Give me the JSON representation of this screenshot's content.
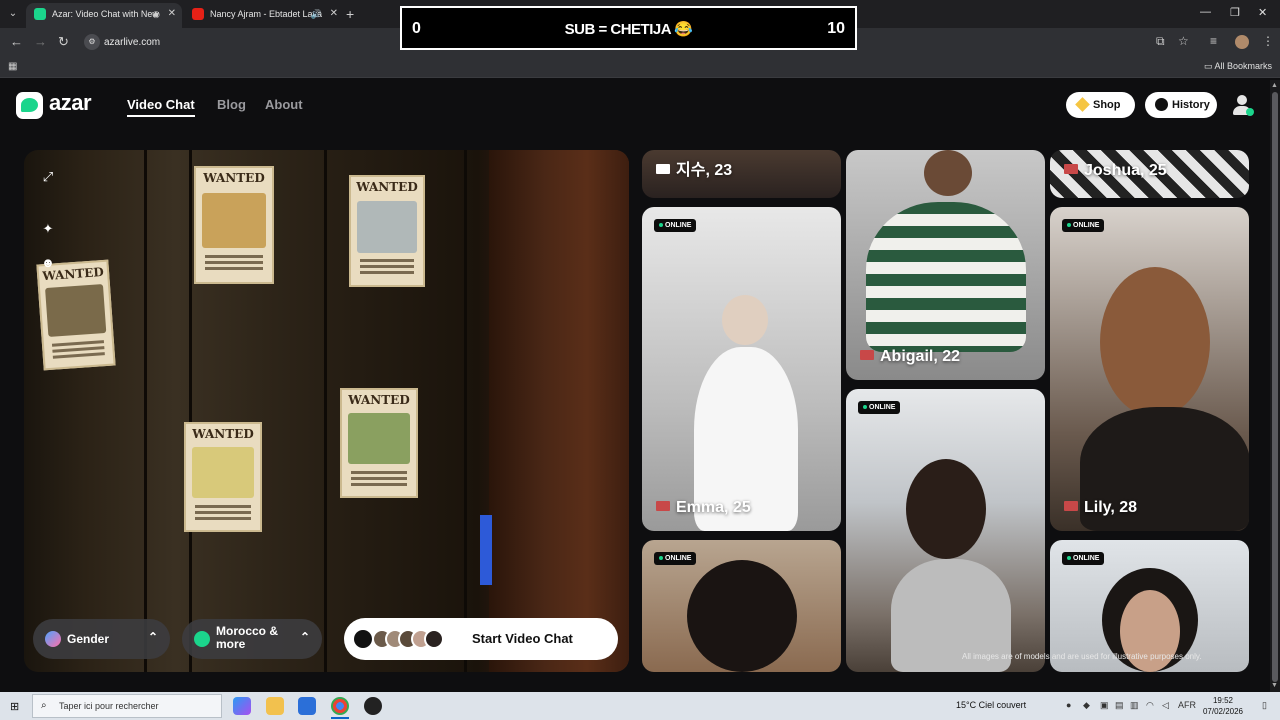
{
  "browser": {
    "tabs": [
      {
        "title": "Azar: Video Chat with New",
        "active": true
      },
      {
        "title": "Nancy Ajram - Ebtadet Laya",
        "active": false
      }
    ],
    "url": "azarlive.com",
    "bookmarks_label": "All Bookmarks"
  },
  "overlay": {
    "left_value": "0",
    "text": "SUB = CHETIJA 😂",
    "right_value": "10"
  },
  "site": {
    "brand": "azar",
    "nav": [
      "Video Chat",
      "Blog",
      "About"
    ],
    "shop_label": "Shop",
    "history_label": "History"
  },
  "controls": {
    "gender_label": "Gender",
    "region_label_1": "Morocco &",
    "region_label_2": "more",
    "start_label": "Start Video Chat"
  },
  "profiles": [
    {
      "name": "지수, 23",
      "online": false
    },
    {
      "name": "Abigail, 22",
      "online": false
    },
    {
      "name": "Joshua, 25",
      "online": false
    },
    {
      "name": "Emma, 25",
      "online": true
    },
    {
      "name": "Lily, 28",
      "online": true
    },
    {
      "name": "",
      "online": true
    },
    {
      "name": "",
      "online": true
    },
    {
      "name": "",
      "online": true
    }
  ],
  "online_label": "ONLINE",
  "disclaimer": "All images are of models and are used for illustrative purposes only.",
  "poster_heading": "WANTED",
  "taskbar": {
    "search_placeholder": "Taper ici pour rechercher",
    "weather": "15°C  Ciel couvert",
    "lang": "AFR",
    "time": "19:52",
    "date": "07/02/2026"
  },
  "colors": {
    "brand_green": "#1bd58c",
    "background": "#0e0e10"
  }
}
